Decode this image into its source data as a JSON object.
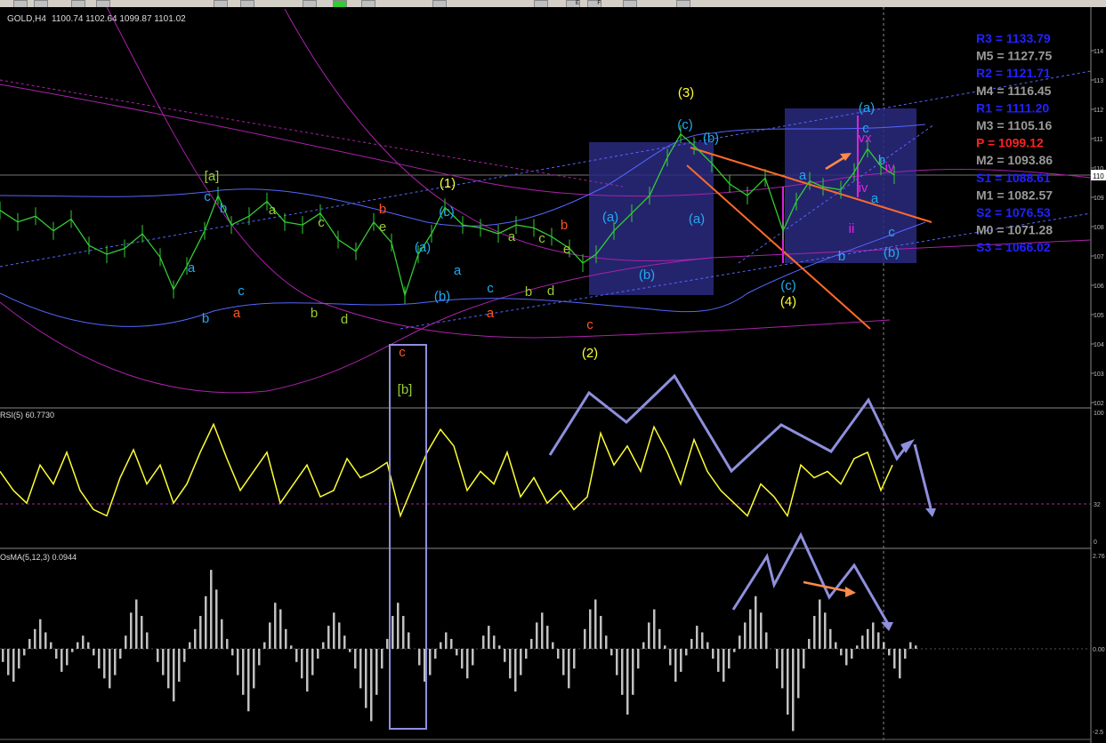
{
  "app": {
    "title": "GOLD,H4",
    "quote": "1100.74 1102.64 1099.87 1101.02",
    "toolbar_letters": [
      "E",
      "F"
    ]
  },
  "colors": {
    "background": "#000000",
    "price": "#33cc33",
    "bands": "#5566ff",
    "ma": "#aa22aa",
    "rsi": "#ffff33",
    "osma": "#c0c0c0",
    "box": "#2a2a80",
    "arrow_overlay": "#8f8fdf",
    "trendline": "#ff6a2a",
    "pivot_blue": "#2222ff",
    "pivot_gray": "#9a9a9a",
    "pivot_red": "#ff2222"
  },
  "pivots": [
    {
      "label": "R3 = 1133.79",
      "color": "#2222ff"
    },
    {
      "label": "M5 = 1127.75",
      "color": "#9a9a9a"
    },
    {
      "label": "R2 = 1121.71",
      "color": "#2222ff"
    },
    {
      "label": "M4 = 1116.45",
      "color": "#9a9a9a"
    },
    {
      "label": "R1 = 1111.20",
      "color": "#2222ff"
    },
    {
      "label": "M3 = 1105.16",
      "color": "#9a9a9a"
    },
    {
      "label": "P  = 1099.12",
      "color": "#ff2222"
    },
    {
      "label": "M2 = 1093.86",
      "color": "#9a9a9a"
    },
    {
      "label": "S1 = 1088.61",
      "color": "#2222ff"
    },
    {
      "label": "M1 = 1082.57",
      "color": "#9a9a9a"
    },
    {
      "label": "S2 = 1076.53",
      "color": "#2222ff"
    },
    {
      "label": "M0 = 1071.28",
      "color": "#9a9a9a"
    },
    {
      "label": "S3 = 1066.02",
      "color": "#2222ff"
    }
  ],
  "wave_labels": [
    {
      "t": "[a]",
      "x": 238,
      "y": 203,
      "c": "#99cc33",
      "s": 26
    },
    {
      "t": "[b]",
      "x": 455,
      "y": 443,
      "c": "#99cc33",
      "s": 26
    },
    {
      "t": "c",
      "x": 233,
      "y": 226,
      "c": "#22aaee"
    },
    {
      "t": "b",
      "x": 251,
      "y": 239,
      "c": "#22aaee"
    },
    {
      "t": "a",
      "x": 215,
      "y": 306,
      "c": "#22aaee"
    },
    {
      "t": "b",
      "x": 231,
      "y": 363,
      "c": "#22aaee"
    },
    {
      "t": "c",
      "x": 271,
      "y": 332,
      "c": "#22aaee"
    },
    {
      "t": "a",
      "x": 266,
      "y": 357,
      "c": "#ff5522"
    },
    {
      "t": "a",
      "x": 306,
      "y": 241,
      "c": "#99cc33"
    },
    {
      "t": "c",
      "x": 361,
      "y": 255,
      "c": "#99cc33"
    },
    {
      "t": "b",
      "x": 353,
      "y": 357,
      "c": "#99cc33"
    },
    {
      "t": "d",
      "x": 387,
      "y": 364,
      "c": "#99cc33"
    },
    {
      "t": "b",
      "x": 430,
      "y": 240,
      "c": "#ff5522"
    },
    {
      "t": "e",
      "x": 430,
      "y": 260,
      "c": "#99cc33"
    },
    {
      "t": "c",
      "x": 452,
      "y": 401,
      "c": "#ff5522"
    },
    {
      "t": "(1)",
      "x": 503,
      "y": 211,
      "c": "#ffff33"
    },
    {
      "t": "(c)",
      "x": 502,
      "y": 243,
      "c": "#22aaee"
    },
    {
      "t": "(a)",
      "x": 475,
      "y": 283,
      "c": "#22aaee"
    },
    {
      "t": "a",
      "x": 514,
      "y": 309,
      "c": "#22aaee"
    },
    {
      "t": "(b)",
      "x": 497,
      "y": 338,
      "c": "#22aaee"
    },
    {
      "t": "c",
      "x": 551,
      "y": 329,
      "c": "#22aaee"
    },
    {
      "t": "a",
      "x": 551,
      "y": 357,
      "c": "#ff5522"
    },
    {
      "t": "a",
      "x": 575,
      "y": 271,
      "c": "#99cc33"
    },
    {
      "t": "c",
      "x": 609,
      "y": 273,
      "c": "#99cc33"
    },
    {
      "t": "e",
      "x": 637,
      "y": 285,
      "c": "#99cc33"
    },
    {
      "t": "b",
      "x": 634,
      "y": 258,
      "c": "#ff5522"
    },
    {
      "t": "b",
      "x": 594,
      "y": 333,
      "c": "#99cc33"
    },
    {
      "t": "d",
      "x": 619,
      "y": 332,
      "c": "#99cc33"
    },
    {
      "t": "c",
      "x": 663,
      "y": 370,
      "c": "#ff5522"
    },
    {
      "t": "(2)",
      "x": 663,
      "y": 402,
      "c": "#ffff33"
    },
    {
      "t": "(3)",
      "x": 771,
      "y": 109,
      "c": "#ffff33"
    },
    {
      "t": "(c)",
      "x": 770,
      "y": 145,
      "c": "#22aaee"
    },
    {
      "t": "(b)",
      "x": 799,
      "y": 160,
      "c": "#22aaee"
    },
    {
      "t": "(a)",
      "x": 686,
      "y": 249,
      "c": "#22aaee"
    },
    {
      "t": "(a)",
      "x": 783,
      "y": 251,
      "c": "#22aaee"
    },
    {
      "t": "(b)",
      "x": 727,
      "y": 314,
      "c": "#22aaee"
    },
    {
      "t": "a",
      "x": 902,
      "y": 202,
      "c": "#22aaee"
    },
    {
      "t": "(c)",
      "x": 886,
      "y": 326,
      "c": "#22aaee"
    },
    {
      "t": "(4)",
      "x": 886,
      "y": 344,
      "c": "#ffff33"
    },
    {
      "t": "(a)",
      "x": 974,
      "y": 126,
      "c": "#22aaee"
    },
    {
      "t": "c",
      "x": 973,
      "y": 149,
      "c": "#22aaee"
    },
    {
      "t": "b",
      "x": 991,
      "y": 185,
      "c": "#22aaee"
    },
    {
      "t": "a",
      "x": 983,
      "y": 228,
      "c": "#22aaee"
    },
    {
      "t": "c",
      "x": 1002,
      "y": 266,
      "c": "#22aaee"
    },
    {
      "t": "(b)",
      "x": 1002,
      "y": 289,
      "c": "#22aaee"
    },
    {
      "t": "b",
      "x": 946,
      "y": 293,
      "c": "#22aaee"
    },
    {
      "t": "vx",
      "x": 972,
      "y": 160,
      "c": "#dd22dd",
      "s": 11
    },
    {
      "t": "iv",
      "x": 1000,
      "y": 193,
      "c": "#dd22dd",
      "s": 11
    },
    {
      "t": "iv",
      "x": 970,
      "y": 216,
      "c": "#dd22dd",
      "s": 11
    },
    {
      "t": "ii",
      "x": 957,
      "y": 262,
      "c": "#dd22dd",
      "s": 11
    }
  ],
  "chart_data": [
    {
      "type": "line",
      "title": "GOLD,H4 1100.74 1102.64 1099.87 1101.02",
      "series": [
        {
          "name": "price",
          "x": [
            0,
            20,
            40,
            60,
            80,
            100,
            120,
            140,
            160,
            180,
            195,
            210,
            230,
            245,
            260,
            280,
            300,
            320,
            340,
            360,
            380,
            400,
            420,
            440,
            455,
            470,
            485,
            500,
            520,
            540,
            560,
            580,
            600,
            620,
            640,
            655,
            670,
            690,
            710,
            730,
            750,
            765,
            780,
            800,
            820,
            840,
            860,
            880,
            895,
            910,
            925,
            945,
            960,
            975,
            990,
            1005
          ],
          "values": [
            1087,
            1083,
            1085,
            1080,
            1084,
            1075,
            1072,
            1074,
            1079,
            1071,
            1060,
            1068,
            1080,
            1092,
            1082,
            1085,
            1090,
            1083,
            1082,
            1086,
            1077,
            1073,
            1083,
            1076,
            1058,
            1072,
            1079,
            1088,
            1082,
            1081,
            1079,
            1082,
            1081,
            1078,
            1074,
            1069,
            1072,
            1080,
            1086,
            1092,
            1105,
            1113,
            1109,
            1103,
            1096,
            1092,
            1098,
            1080,
            1090,
            1097,
            1095,
            1094,
            1100,
            1108,
            1102,
            1099
          ]
        }
      ],
      "yticks": [
        "114",
        "113",
        "112",
        "111",
        "110",
        "109",
        "108",
        "107",
        "106",
        "105",
        "104",
        "103",
        "102"
      ],
      "current_price_label": "110"
    },
    {
      "type": "line",
      "title": "RSI(5) 60.7730",
      "series": [
        {
          "name": "RSI(5)",
          "x": [
            0,
            15,
            30,
            45,
            60,
            75,
            90,
            105,
            120,
            135,
            150,
            165,
            180,
            195,
            210,
            225,
            240,
            255,
            270,
            285,
            300,
            315,
            330,
            345,
            360,
            375,
            390,
            405,
            420,
            435,
            450,
            465,
            480,
            495,
            510,
            525,
            540,
            555,
            570,
            585,
            600,
            615,
            630,
            645,
            660,
            675,
            690,
            705,
            720,
            735,
            750,
            765,
            780,
            795,
            810,
            825,
            840,
            855,
            870,
            885,
            900,
            915,
            930,
            945,
            960,
            975,
            990,
            1003
          ],
          "values": [
            55,
            40,
            30,
            60,
            45,
            70,
            40,
            25,
            20,
            50,
            72,
            45,
            60,
            30,
            45,
            70,
            92,
            65,
            40,
            55,
            70,
            30,
            45,
            60,
            35,
            40,
            65,
            50,
            55,
            62,
            20,
            45,
            70,
            88,
            75,
            40,
            55,
            45,
            70,
            35,
            50,
            30,
            40,
            25,
            35,
            85,
            60,
            75,
            55,
            90,
            70,
            45,
            80,
            55,
            40,
            30,
            20,
            45,
            35,
            20,
            60,
            50,
            55,
            45,
            65,
            70,
            40,
            60
          ]
        }
      ],
      "ylim": [
        0,
        100
      ],
      "yticks": [
        "100",
        "32",
        "0"
      ]
    },
    {
      "type": "bar",
      "title": "OsMA(5,12,3) 0.0944",
      "series": [
        {
          "name": "OsMA(5,12,3)",
          "values": [
            -0.4,
            -0.8,
            -1.0,
            -0.6,
            -0.2,
            0.3,
            0.6,
            0.9,
            0.5,
            0.2,
            -0.3,
            -0.7,
            -0.5,
            -0.1,
            0.2,
            0.4,
            0.2,
            -0.2,
            -0.6,
            -0.9,
            -1.2,
            -0.8,
            -0.3,
            0.4,
            1.1,
            1.5,
            1.0,
            0.5,
            0.0,
            -0.4,
            -0.8,
            -1.2,
            -1.6,
            -1.0,
            -0.4,
            0.2,
            0.6,
            1.0,
            1.6,
            2.4,
            1.8,
            0.9,
            0.3,
            -0.2,
            -0.8,
            -1.4,
            -1.9,
            -1.2,
            -0.5,
            0.2,
            0.8,
            1.4,
            1.2,
            0.6,
            0.1,
            -0.4,
            -0.9,
            -1.3,
            -0.8,
            -0.3,
            0.2,
            0.7,
            1.1,
            0.8,
            0.4,
            -0.1,
            -0.6,
            -1.2,
            -1.8,
            -2.2,
            -1.4,
            -0.6,
            0.3,
            1.0,
            1.4,
            1.0,
            0.5,
            0.0,
            -0.5,
            -1.0,
            -0.8,
            -0.3,
            0.2,
            0.5,
            0.3,
            -0.2,
            -0.6,
            -0.9,
            -0.5,
            0.0,
            0.4,
            0.7,
            0.4,
            0.1,
            -0.4,
            -0.9,
            -1.3,
            -0.8,
            -0.3,
            0.3,
            0.8,
            1.1,
            0.7,
            0.2,
            -0.3,
            -0.8,
            -1.2,
            -0.6,
            0.0,
            0.6,
            1.2,
            1.5,
            1.0,
            0.4,
            -0.2,
            -0.8,
            -1.4,
            -2.0,
            -1.4,
            -0.6,
            0.2,
            0.8,
            1.2,
            0.6,
            0.1,
            -0.5,
            -1.0,
            -0.7,
            -0.2,
            0.3,
            0.7,
            0.5,
            0.2,
            -0.3,
            -0.7,
            -1.0,
            -0.6,
            -0.1,
            0.4,
            0.8,
            1.2,
            1.6,
            1.1,
            0.5,
            0.0,
            -0.6,
            -1.2,
            -2.0,
            -2.5,
            -1.5,
            -0.6,
            0.3,
            1.0,
            1.5,
            1.1,
            0.6,
            0.2,
            -0.2,
            -0.5,
            -0.3,
            0.1,
            0.4,
            0.6,
            0.8,
            0.5,
            0.2,
            -0.2,
            -0.6,
            -0.9,
            -0.3,
            0.2,
            0.1
          ]
        }
      ],
      "ylim": [
        -2.5,
        2.76
      ],
      "yticks": [
        "2.76",
        "0.00",
        "-2.5"
      ]
    }
  ]
}
